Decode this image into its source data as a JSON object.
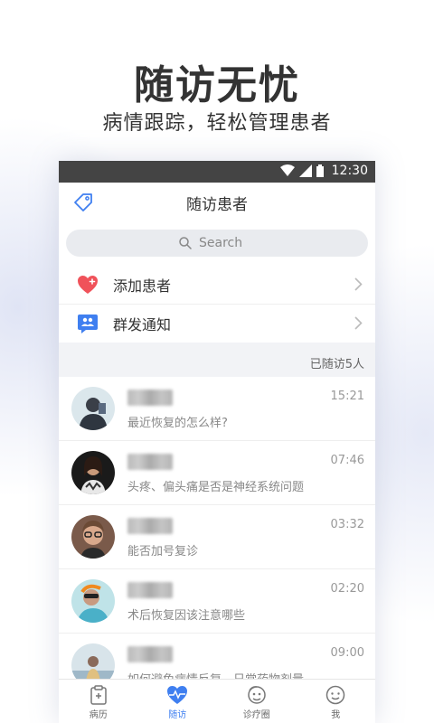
{
  "promo": {
    "title": "随访无忧",
    "subtitle": "病情跟踪，轻松管理患者"
  },
  "status_bar": {
    "time": "12:30",
    "icons": [
      "wifi-icon",
      "signal-icon",
      "battery-icon"
    ]
  },
  "header": {
    "title": "随访患者",
    "left_icon": "tag-icon"
  },
  "search": {
    "placeholder": "Search"
  },
  "actions": [
    {
      "label": "添加患者",
      "icon": "heart-plus-icon"
    },
    {
      "label": "群发通知",
      "icon": "group-message-icon"
    }
  ],
  "followed_count": "已随访5人",
  "patients": [
    {
      "message": "最近恢复的怎么样?",
      "time": "15:21"
    },
    {
      "message": "头疼、偏头痛是否是神经系统问题",
      "time": "07:46"
    },
    {
      "message": "能否加号复诊",
      "time": "03:32"
    },
    {
      "message": "术后恢复因该注意哪些",
      "time": "02:20"
    },
    {
      "message": "如何避免病情反复，日常药物剂量",
      "time": "09:00"
    }
  ],
  "tabs": [
    {
      "label": "病历",
      "icon": "clipboard-icon",
      "active": false
    },
    {
      "label": "随访",
      "icon": "heartbeat-icon",
      "active": true
    },
    {
      "label": "诊疗圈",
      "icon": "community-icon",
      "active": false
    },
    {
      "label": "我",
      "icon": "smiley-icon",
      "active": false
    }
  ],
  "colors": {
    "accent": "#3f7ff0",
    "heart": "#f0525a",
    "status_bar": "#444444",
    "background": "#f2f3f6"
  }
}
